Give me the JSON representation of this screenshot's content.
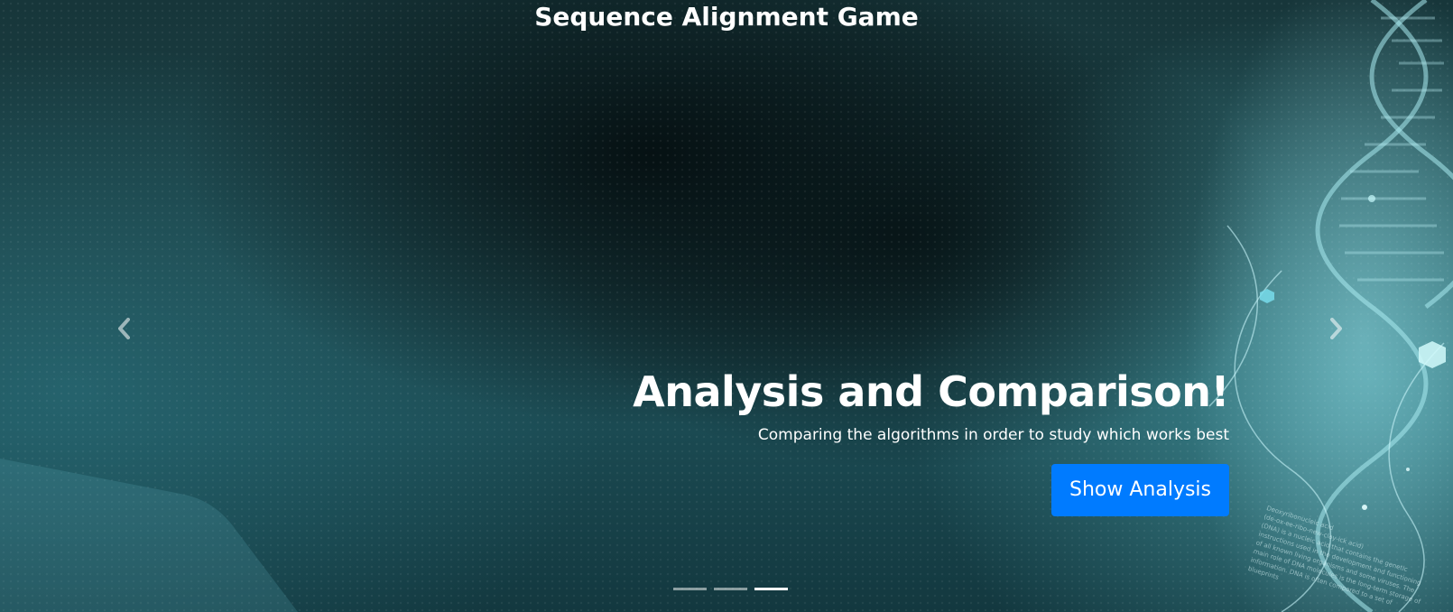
{
  "header": {
    "title": "Sequence Alignment Game"
  },
  "carousel": {
    "prev_icon": "chevron-left-icon",
    "next_icon": "chevron-right-icon",
    "slide_count": 3,
    "active_slide": 3,
    "caption": {
      "heading": "Analysis and Comparison!",
      "text": "Comparing the algorithms in order to study which works best",
      "button_label": "Show Analysis"
    },
    "background_caption": "Deoxyribonucleic acid\n(de-ox-ee-ribo-new-clay-ick acid)\n(DNA) is a nucleic acid that contains the genetic\ninstructions used in the development and functioning\nof all known living organisms and some viruses. The\nmain role of DNA molecules is the long-term storage of\ninformation. DNA is often compared to a set of\nblueprints"
  },
  "colors": {
    "button": "#007bff",
    "background_dark": "#0d2327",
    "background_teal": "#1c4348",
    "helix": "#9fe6ee"
  }
}
